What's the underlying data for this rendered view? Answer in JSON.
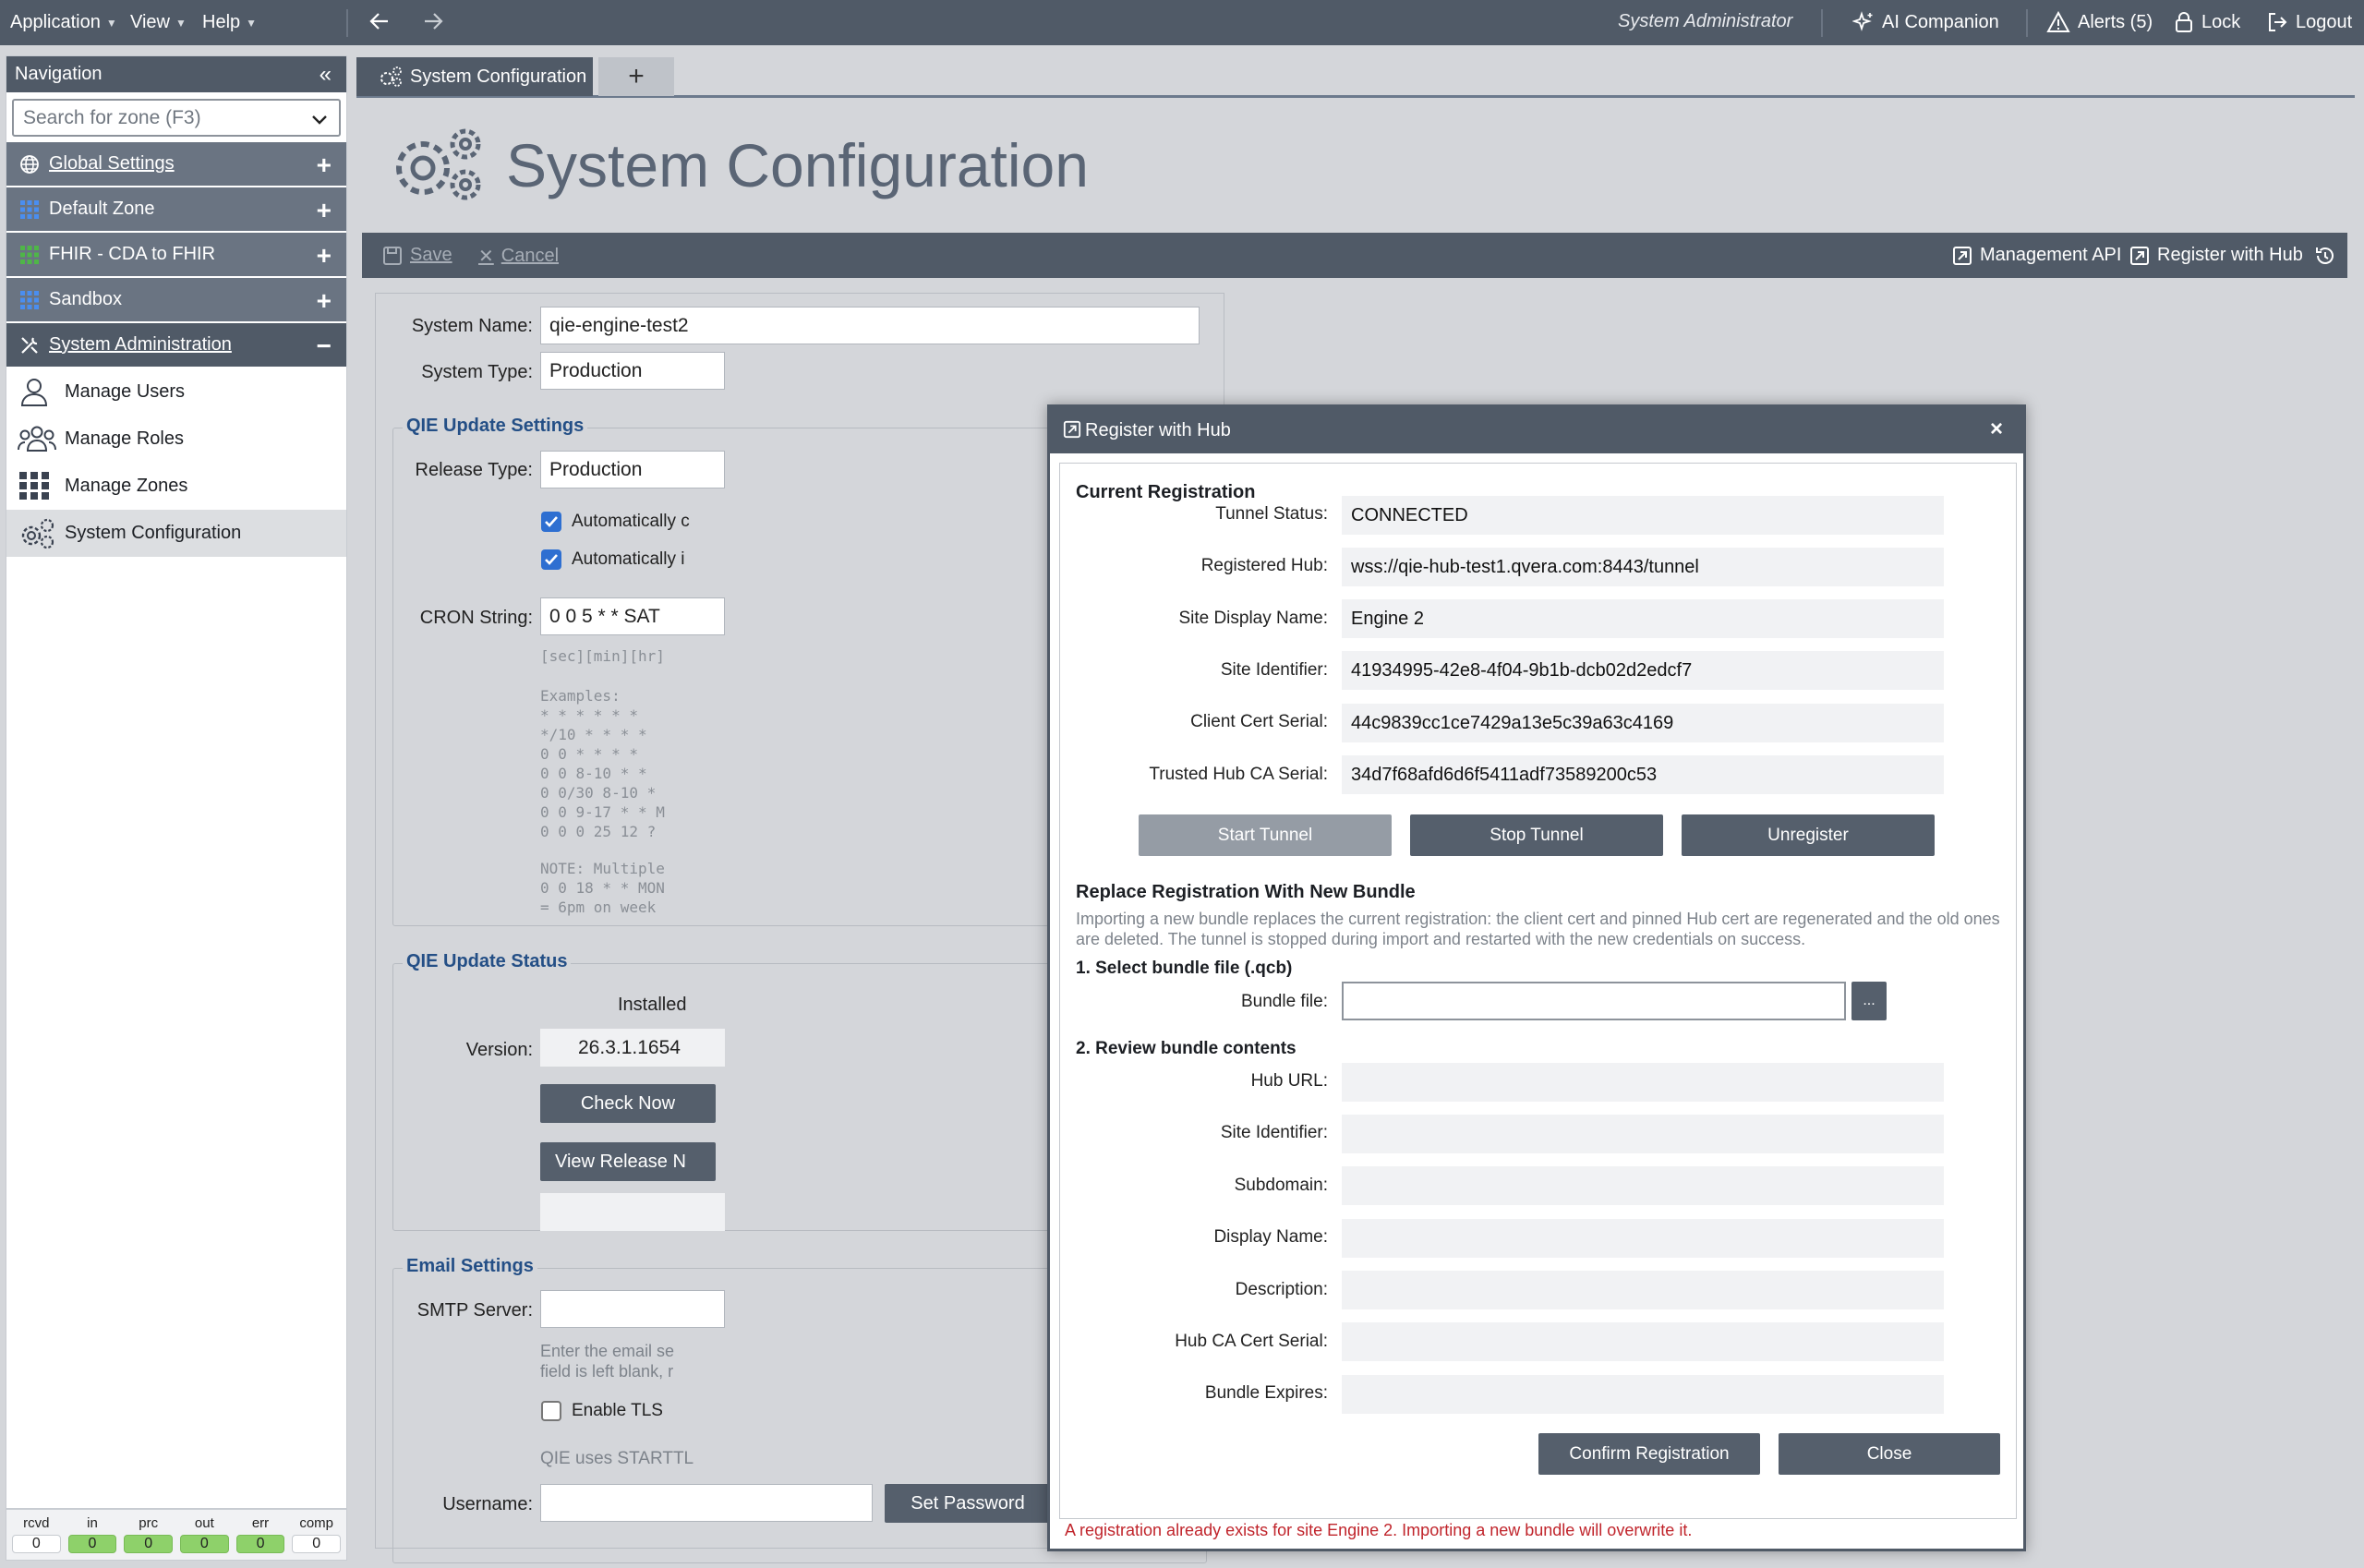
{
  "menubar": {
    "items": [
      {
        "label": "Application"
      },
      {
        "label": "View"
      },
      {
        "label": "Help"
      }
    ],
    "user": "System Administrator",
    "ai_companion": "AI Companion",
    "alerts": "Alerts (5)",
    "lock": "Lock",
    "logout": "Logout"
  },
  "sidebar": {
    "title": "Navigation",
    "search_placeholder": "Search for zone (F3)",
    "zones": [
      {
        "label": "Global Settings",
        "icon": "globe-icon",
        "color": "#ffffff"
      },
      {
        "label": "Default Zone",
        "icon": "grid-icon",
        "color": "#4a8ef0"
      },
      {
        "label": "FHIR - CDA to FHIR",
        "icon": "grid-icon",
        "color": "#4fb648"
      },
      {
        "label": "Sandbox",
        "icon": "grid-icon",
        "color": "#4a8ef0"
      },
      {
        "label": "System Administration",
        "icon": "tools-icon"
      }
    ],
    "admin_items": [
      {
        "label": "Manage Users",
        "icon": "user-icon"
      },
      {
        "label": "Manage Roles",
        "icon": "users-icon"
      },
      {
        "label": "Manage Zones",
        "icon": "grid-icon"
      },
      {
        "label": "System Configuration",
        "icon": "gears-icon"
      }
    ],
    "stats": [
      {
        "label": "rcvd",
        "value": "0"
      },
      {
        "label": "in",
        "value": "0"
      },
      {
        "label": "prc",
        "value": "0"
      },
      {
        "label": "out",
        "value": "0"
      },
      {
        "label": "err",
        "value": "0"
      },
      {
        "label": "comp",
        "value": "0"
      }
    ]
  },
  "tabs": {
    "active": "System Configuration",
    "add": "+"
  },
  "page": {
    "title": "System Configuration"
  },
  "toolbar": {
    "save": "Save",
    "cancel": "Cancel",
    "management_api": "Management API",
    "register_hub": "Register with Hub"
  },
  "form": {
    "system_name_label": "System Name:",
    "system_name": "qie-engine-test2",
    "system_type_label": "System Type:",
    "system_type": "Production",
    "update_group": "QIE Update Settings",
    "release_type_label": "Release Type:",
    "release_type": "Production",
    "auto1": "Automatically c",
    "auto2": "Automatically i",
    "cron_label": "CRON String:",
    "cron": "0 0 5 * * SAT",
    "cron_hint": "[sec][min][hr]",
    "examples": "Examples:\n* * * * * *\n*/10 * * * *\n0 0 * * * *\n0 0 8-10 * *\n0 0/30 8-10 *\n0 0 9-17 * * M\n0 0 0 25 12 ?",
    "note": "NOTE: Multiple\n0 0 18 * * MON\n= 6pm on week",
    "status_group": "QIE Update Status",
    "installed": "Installed",
    "version_label": "Version:",
    "version": "26.3.1.1654",
    "check_now": "Check Now",
    "release_notes": "View Release N",
    "email_group": "Email Settings",
    "smtp_label": "SMTP Server:",
    "smtp_hint": "Enter the email se\nfield is left blank, r",
    "enable_tls": "Enable TLS",
    "starttls": "QIE uses STARTTL",
    "username_label": "Username:",
    "set_password": "Set Password"
  },
  "dialog": {
    "title": "Register with Hub",
    "current_heading": "Current Registration",
    "fields": [
      {
        "label": "Tunnel Status:",
        "value": "CONNECTED"
      },
      {
        "label": "Registered Hub:",
        "value": "wss://qie-hub-test1.qvera.com:8443/tunnel"
      },
      {
        "label": "Site Display Name:",
        "value": "Engine 2"
      },
      {
        "label": "Site Identifier:",
        "value": "41934995-42e8-4f04-9b1b-dcb02d2edcf7"
      },
      {
        "label": "Client Cert Serial:",
        "value": "44c9839cc1ce7429a13e5c39a63c4169"
      },
      {
        "label": "Trusted Hub CA Serial:",
        "value": "34d7f68afd6d6f5411adf73589200c53"
      }
    ],
    "start_tunnel": "Start Tunnel",
    "stop_tunnel": "Stop Tunnel",
    "unregister": "Unregister",
    "replace_heading": "Replace Registration With New Bundle",
    "replace_desc": "Importing a new bundle replaces the current registration: the client cert and pinned Hub cert are regenerated and the old ones are deleted. The tunnel is stopped during import and restarted with the new credentials on success.",
    "step1": "1. Select bundle file (.qcb)",
    "bundle_file_label": "Bundle file:",
    "bundle_file": "",
    "browse": "...",
    "step2": "2. Review bundle contents",
    "review": [
      {
        "label": "Hub URL:",
        "value": ""
      },
      {
        "label": "Site Identifier:",
        "value": ""
      },
      {
        "label": "Subdomain:",
        "value": ""
      },
      {
        "label": "Display Name:",
        "value": ""
      },
      {
        "label": "Description:",
        "value": ""
      },
      {
        "label": "Hub CA Cert Serial:",
        "value": ""
      },
      {
        "label": "Bundle Expires:",
        "value": ""
      }
    ],
    "confirm": "Confirm Registration",
    "close": "Close",
    "warning": "A registration already exists for site Engine 2. Importing a new bundle will overwrite it."
  }
}
